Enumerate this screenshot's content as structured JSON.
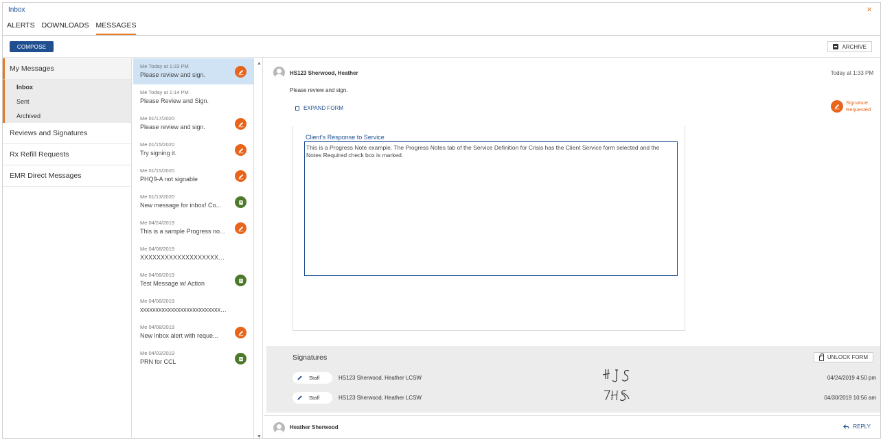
{
  "window": {
    "title": "Inbox",
    "close_symbol": "×"
  },
  "tabs": [
    {
      "label": "ALERTS",
      "active": false
    },
    {
      "label": "DOWNLOADS",
      "active": false
    },
    {
      "label": "MESSAGES",
      "active": true
    }
  ],
  "toolbar": {
    "compose_label": "COMPOSE",
    "archive_label": "ARCHIVE"
  },
  "sidebar": {
    "my_messages": "My Messages",
    "sub_items": [
      {
        "label": "Inbox",
        "active": true
      },
      {
        "label": "Sent",
        "active": false
      },
      {
        "label": "Archived",
        "active": false
      }
    ],
    "reviews": "Reviews and Signatures",
    "rx_refill": "Rx Refill Requests",
    "emr_direct": "EMR Direct Messages"
  },
  "messages": [
    {
      "meta": "Me Today at 1:33 PM",
      "subject": "Please review and sign.",
      "icon": "pencil",
      "active": true
    },
    {
      "meta": "Me Today at 1:14 PM",
      "subject": "Please Review and Sign.",
      "icon": "none"
    },
    {
      "meta": "Me 01/17/2020",
      "subject": "Please review and sign.",
      "icon": "pencil"
    },
    {
      "meta": "Me 01/15/2020",
      "subject": "Try signing it.",
      "icon": "pencil"
    },
    {
      "meta": "Me 01/15/2020",
      "subject": "PHQ9-A not signable",
      "icon": "pencil"
    },
    {
      "meta": "Me 01/13/2020",
      "subject": "New message for inbox! Co...",
      "icon": "note"
    },
    {
      "meta": "Me 04/24/2019",
      "subject": "This is a sample Progress no...",
      "icon": "pencil"
    },
    {
      "meta": "Me 04/08/2019",
      "subject": "XXXXXXXXXXXXXXXXXXXXXX...",
      "icon": "none"
    },
    {
      "meta": "Me 04/08/2019",
      "subject": "Test Message w/ Action",
      "icon": "note"
    },
    {
      "meta": "Me 04/08/2019",
      "subject": "xxxxxxxxxxxxxxxxxxxxxxxxxxx...",
      "icon": "none"
    },
    {
      "meta": "Me 04/08/2019",
      "subject": "New inbox alert with reque...",
      "icon": "pencil"
    },
    {
      "meta": "Me 04/03/2019",
      "subject": "PRN for CCL",
      "icon": "note"
    }
  ],
  "detail": {
    "sender": "HS123 Sherwood, Heather",
    "time": "Today at 1:33 PM",
    "body": "Please review and sign.",
    "expand_label": "EXPAND FORM",
    "signature_status": "Signature Requested",
    "form_label": "Client's Response to Service",
    "form_text": "This is a Progress Note example. The Progress Notes tab of the Service Definition for Crisis has the Client Service form selected and the Notes Required check box is marked."
  },
  "signatures": {
    "title": "Signatures",
    "unlock_label": "UNLOCK FORM",
    "rows": [
      {
        "role": "Staff",
        "name": "HS123 Sherwood, Heather LCSW",
        "date": "04/24/2019 4:50 pm"
      },
      {
        "role": "Staff",
        "name": "HS123 Sherwood, Heather LCSW",
        "date": "04/30/2019 10:56 am"
      }
    ]
  },
  "reply": {
    "name": "Heather Sherwood",
    "label": "REPLY"
  },
  "colors": {
    "brand_blue": "#1f4f8f",
    "accent_orange": "#e87722",
    "sign_orange": "#e8641a",
    "note_green": "#4d7a2a",
    "selected_bg": "#cfe3f5"
  }
}
